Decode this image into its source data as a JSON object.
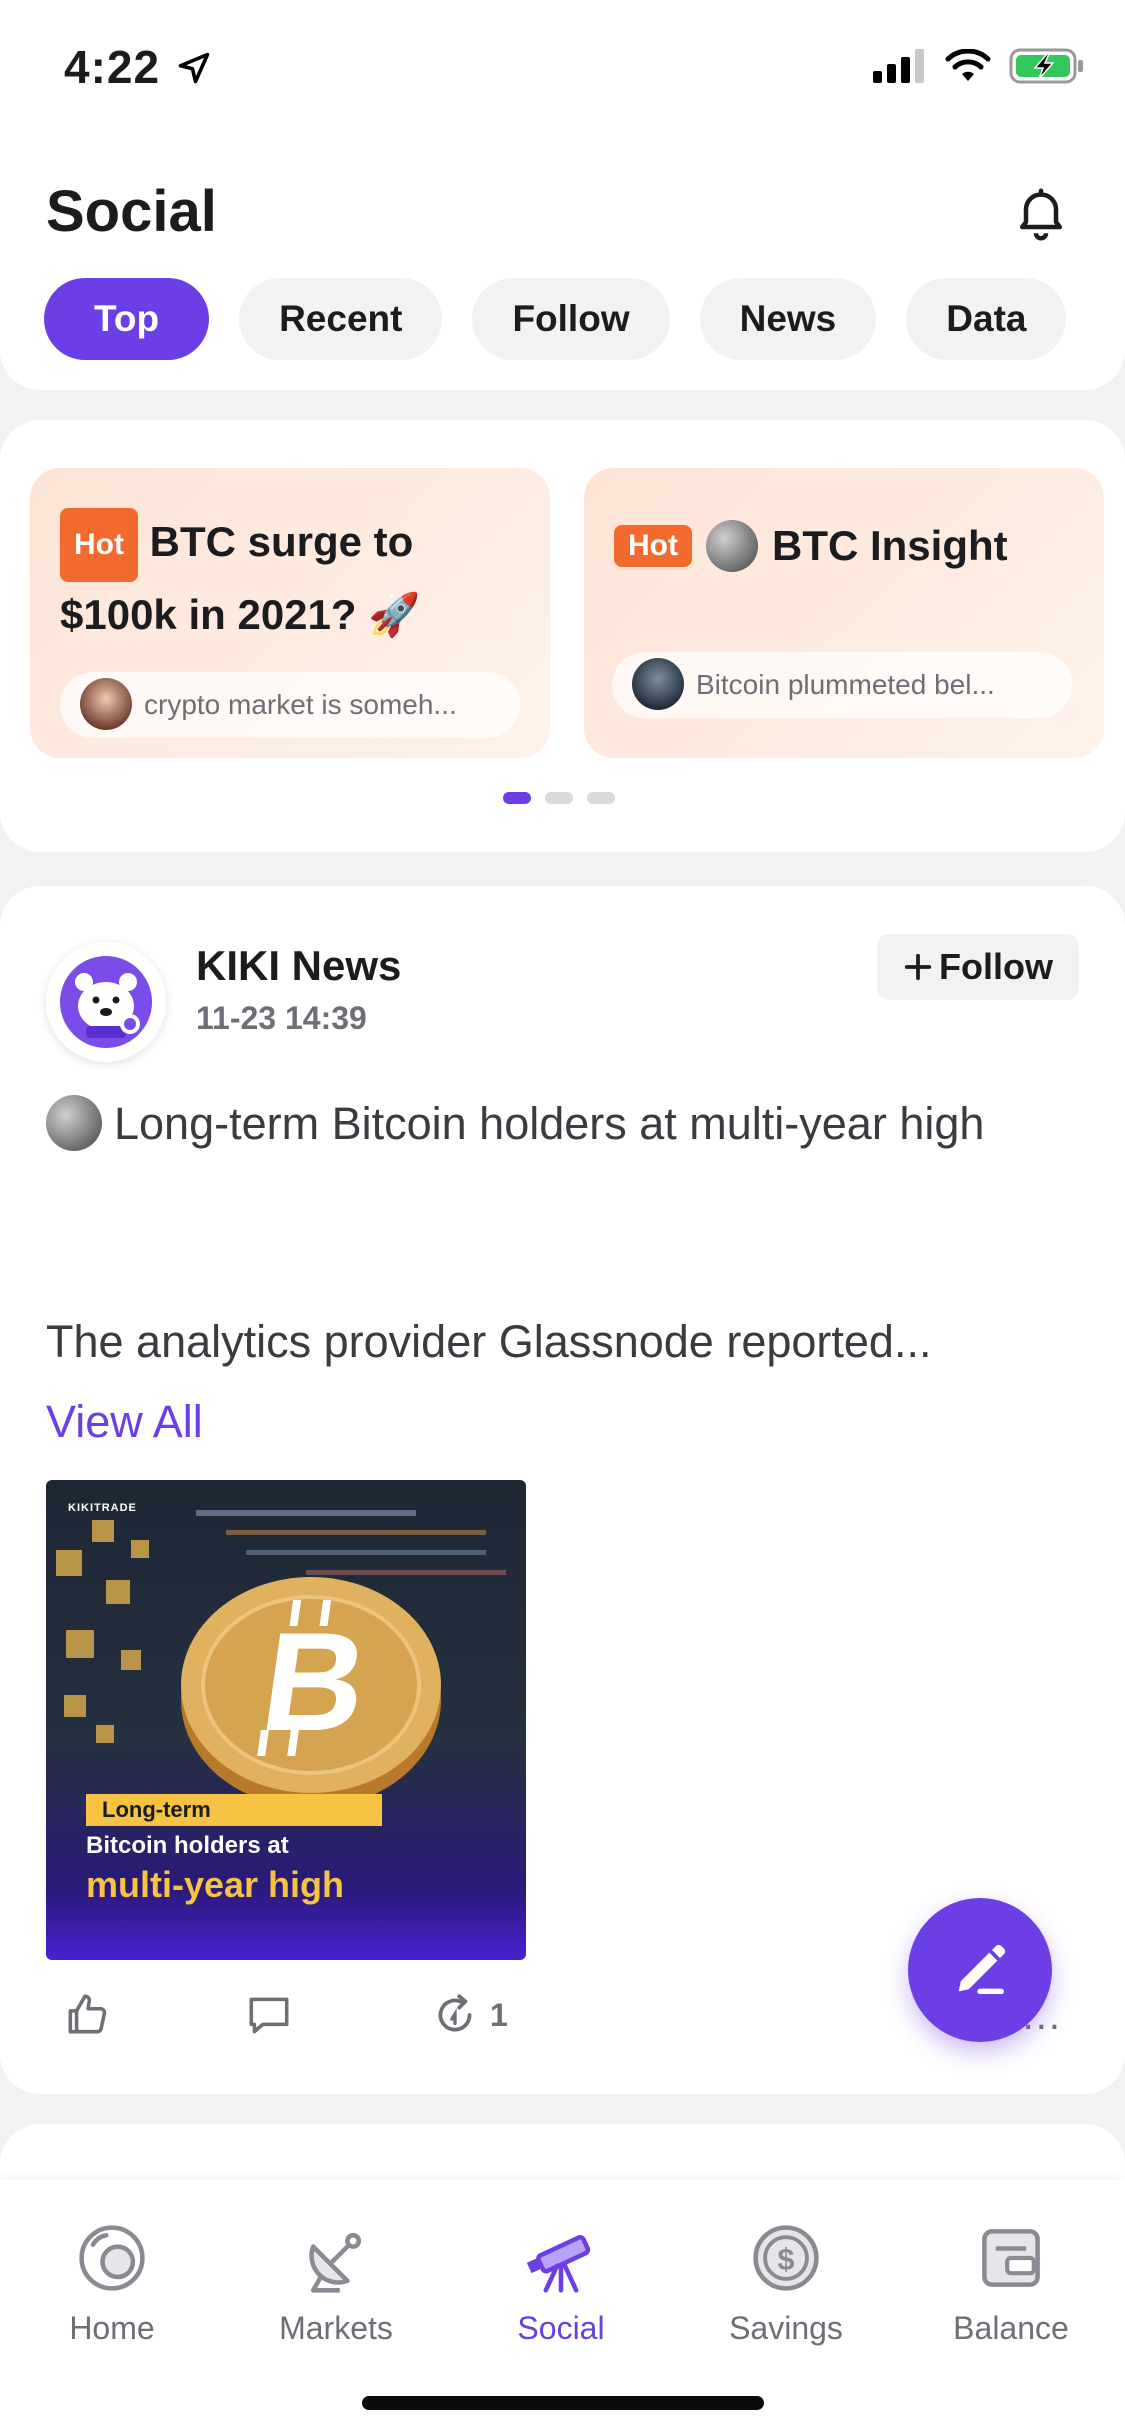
{
  "status_bar": {
    "time": "4:22",
    "icons": [
      "location-arrow-icon",
      "signal-icon",
      "wifi-icon",
      "battery-charging-icon"
    ]
  },
  "header": {
    "title": "Social",
    "tabs": [
      {
        "label": "Top",
        "active": true
      },
      {
        "label": "Recent",
        "active": false
      },
      {
        "label": "Follow",
        "active": false
      },
      {
        "label": "News",
        "active": false
      },
      {
        "label": "Data",
        "active": false
      }
    ]
  },
  "hot": {
    "badge": "Hot",
    "cards": [
      {
        "title": "BTC surge to $100k in 2021? 🚀",
        "comment": "crypto market is someh..."
      },
      {
        "title": "BTC Insight",
        "comment": "Bitcoin plummeted bel..."
      }
    ],
    "active_page": 1,
    "pages": 3
  },
  "post": {
    "author": "KIKI News",
    "time": "11-23 14:39",
    "follow_label": "Follow",
    "headline": "Long-term Bitcoin holders at multi-year high",
    "body": "The analytics provider Glassnode reported...",
    "view_all": "View All",
    "image": {
      "brand": "KIKITRADE",
      "line1": "Long-term",
      "line2": "Bitcoin holders at",
      "line3": "multi-year high"
    },
    "repost_count": "1",
    "more": "..."
  },
  "bottom_nav": [
    {
      "label": "Home",
      "active": false
    },
    {
      "label": "Markets",
      "active": false
    },
    {
      "label": "Social",
      "active": true
    },
    {
      "label": "Savings",
      "active": false
    },
    {
      "label": "Balance",
      "active": false
    }
  ],
  "colors": {
    "accent": "#6c3fe6",
    "hot": "#f26a2e",
    "gold": "#f6c343"
  }
}
